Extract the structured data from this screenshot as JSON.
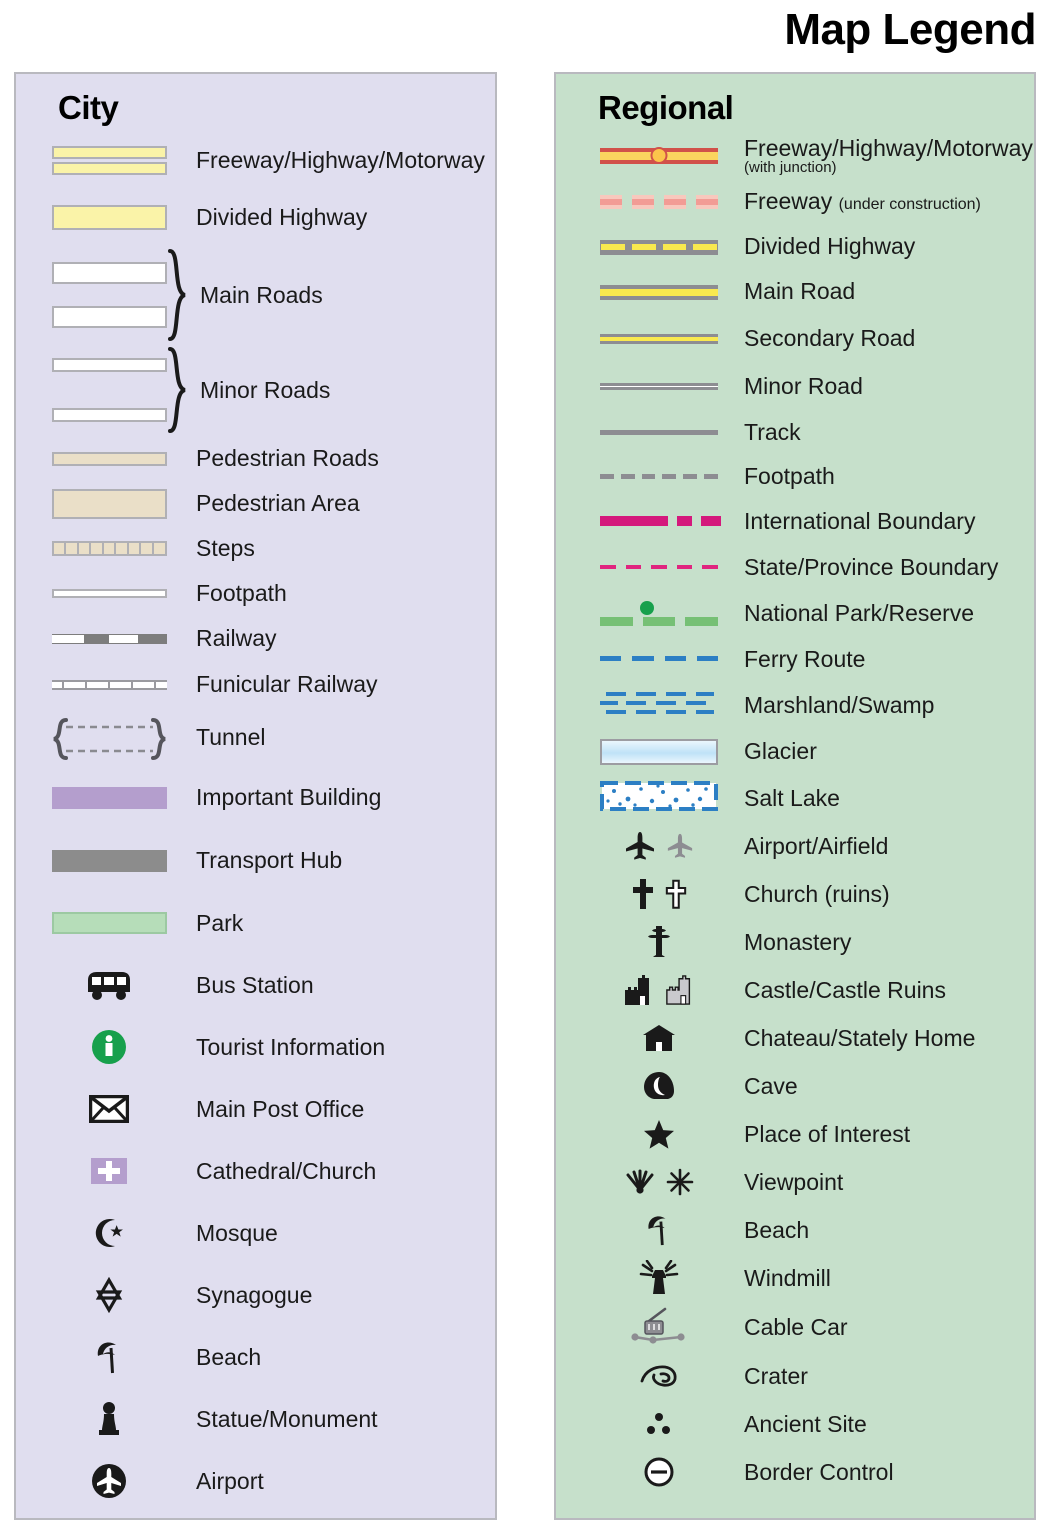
{
  "title": "Map Legend",
  "panels": {
    "city": {
      "heading": "City",
      "bg_color": "#e0deef",
      "items": [
        {
          "label": "Freeway/Highway/Motorway",
          "symbol": "freeway-double-band"
        },
        {
          "label": "Divided Highway",
          "symbol": "divided-highway-band"
        },
        {
          "label": "Main Roads",
          "symbol": "main-roads-pair-brace"
        },
        {
          "label": "Minor Roads",
          "symbol": "minor-roads-pair-brace"
        },
        {
          "label": "Pedestrian Roads",
          "symbol": "pedestrian-road-band"
        },
        {
          "label": "Pedestrian Area",
          "symbol": "pedestrian-area-block"
        },
        {
          "label": "Steps",
          "symbol": "steps-hatched-band"
        },
        {
          "label": "Footpath",
          "symbol": "footpath-thin-line"
        },
        {
          "label": "Railway",
          "symbol": "railway-dashed-line"
        },
        {
          "label": "Funicular Railway",
          "symbol": "funicular-ticked-line"
        },
        {
          "label": "Tunnel",
          "symbol": "tunnel-bracket-dashed"
        },
        {
          "label": "Important Building",
          "symbol": "important-building-swatch"
        },
        {
          "label": "Transport Hub",
          "symbol": "transport-hub-swatch"
        },
        {
          "label": "Park",
          "symbol": "park-swatch"
        },
        {
          "label": "Bus Station",
          "symbol": "bus-icon"
        },
        {
          "label": "Tourist Information",
          "symbol": "information-icon"
        },
        {
          "label": "Main Post Office",
          "symbol": "envelope-icon"
        },
        {
          "label": "Cathedral/Church",
          "symbol": "church-cross-square-icon"
        },
        {
          "label": "Mosque",
          "symbol": "crescent-star-icon"
        },
        {
          "label": "Synagogue",
          "symbol": "star-of-david-icon"
        },
        {
          "label": "Beach",
          "symbol": "beach-umbrella-icon"
        },
        {
          "label": "Statue/Monument",
          "symbol": "statue-monument-icon"
        },
        {
          "label": "Airport",
          "symbol": "airport-circle-icon"
        }
      ]
    },
    "regional": {
      "heading": "Regional",
      "bg_color": "#c6e0cb",
      "items": [
        {
          "label": "Freeway/Highway/Motorway",
          "sublabel": "(with junction)",
          "symbol": "freeway-junction-line"
        },
        {
          "label": "Freeway",
          "inline_note": "(under construction)",
          "symbol": "freeway-under-construction-dashes"
        },
        {
          "label": "Divided Highway",
          "symbol": "divided-highway-dashed-line"
        },
        {
          "label": "Main Road",
          "symbol": "main-road-yellow-line"
        },
        {
          "label": "Secondary Road",
          "symbol": "secondary-road-yellow-line"
        },
        {
          "label": "Minor Road",
          "symbol": "minor-road-white-line"
        },
        {
          "label": "Track",
          "symbol": "track-gray-line"
        },
        {
          "label": "Footpath",
          "symbol": "footpath-gray-dashes"
        },
        {
          "label": "International Boundary",
          "symbol": "international-boundary-magenta-dashdot"
        },
        {
          "label": "State/Province Boundary",
          "symbol": "state-boundary-pink-dashes"
        },
        {
          "label": "National Park/Reserve",
          "symbol": "national-park-green-dashes-dot"
        },
        {
          "label": "Ferry Route",
          "symbol": "ferry-route-blue-dashes"
        },
        {
          "label": "Marshland/Swamp",
          "symbol": "marshland-blue-ticks"
        },
        {
          "label": "Glacier",
          "symbol": "glacier-gradient-swatch"
        },
        {
          "label": "Salt Lake",
          "symbol": "salt-lake-stippled-swatch"
        },
        {
          "label": "Airport/Airfield",
          "symbol": "airplane-pair-icon"
        },
        {
          "label": "Church (ruins)",
          "symbol": "church-cross-pair-icon"
        },
        {
          "label": "Monastery",
          "symbol": "monastery-cross-icon"
        },
        {
          "label": "Castle/Castle Ruins",
          "symbol": "castle-pair-icon"
        },
        {
          "label": "Chateau/Stately Home",
          "symbol": "chateau-icon"
        },
        {
          "label": "Cave",
          "symbol": "cave-icon"
        },
        {
          "label": "Place of Interest",
          "symbol": "star-icon"
        },
        {
          "label": "Viewpoint",
          "symbol": "viewpoint-pair-icon"
        },
        {
          "label": "Beach",
          "symbol": "beach-umbrella-icon"
        },
        {
          "label": "Windmill",
          "symbol": "windmill-icon"
        },
        {
          "label": "Cable Car",
          "symbol": "cable-car-icon"
        },
        {
          "label": "Crater",
          "symbol": "crater-icon"
        },
        {
          "label": "Ancient Site",
          "symbol": "ancient-site-dots-icon"
        },
        {
          "label": "Border Control",
          "symbol": "border-control-icon"
        }
      ]
    }
  },
  "colors": {
    "city_panel": "#e0deef",
    "regional_panel": "#c6e0cb",
    "panel_border": "#b9b9bf",
    "road_yellow": "#f9e94f",
    "city_yellow": "#faf3a8",
    "freeway_red": "#d1514a",
    "junction_orange": "#fbc44b",
    "under_construction_pink": "#f29c95",
    "gray_casing": "#8d8d92",
    "boundary_magenta": "#d4197c",
    "state_boundary_pink": "#e0257f",
    "national_park_green": "#76c075",
    "park_dot_green": "#17a04c",
    "ferry_blue": "#2c7fc4",
    "pedestrian_beige": "#eadfc8",
    "important_building_purple": "#b49ecd",
    "transport_hub_gray": "#8c8c8c",
    "park_green": "#b6ddb9",
    "tourist_info_green": "#17a04c"
  }
}
